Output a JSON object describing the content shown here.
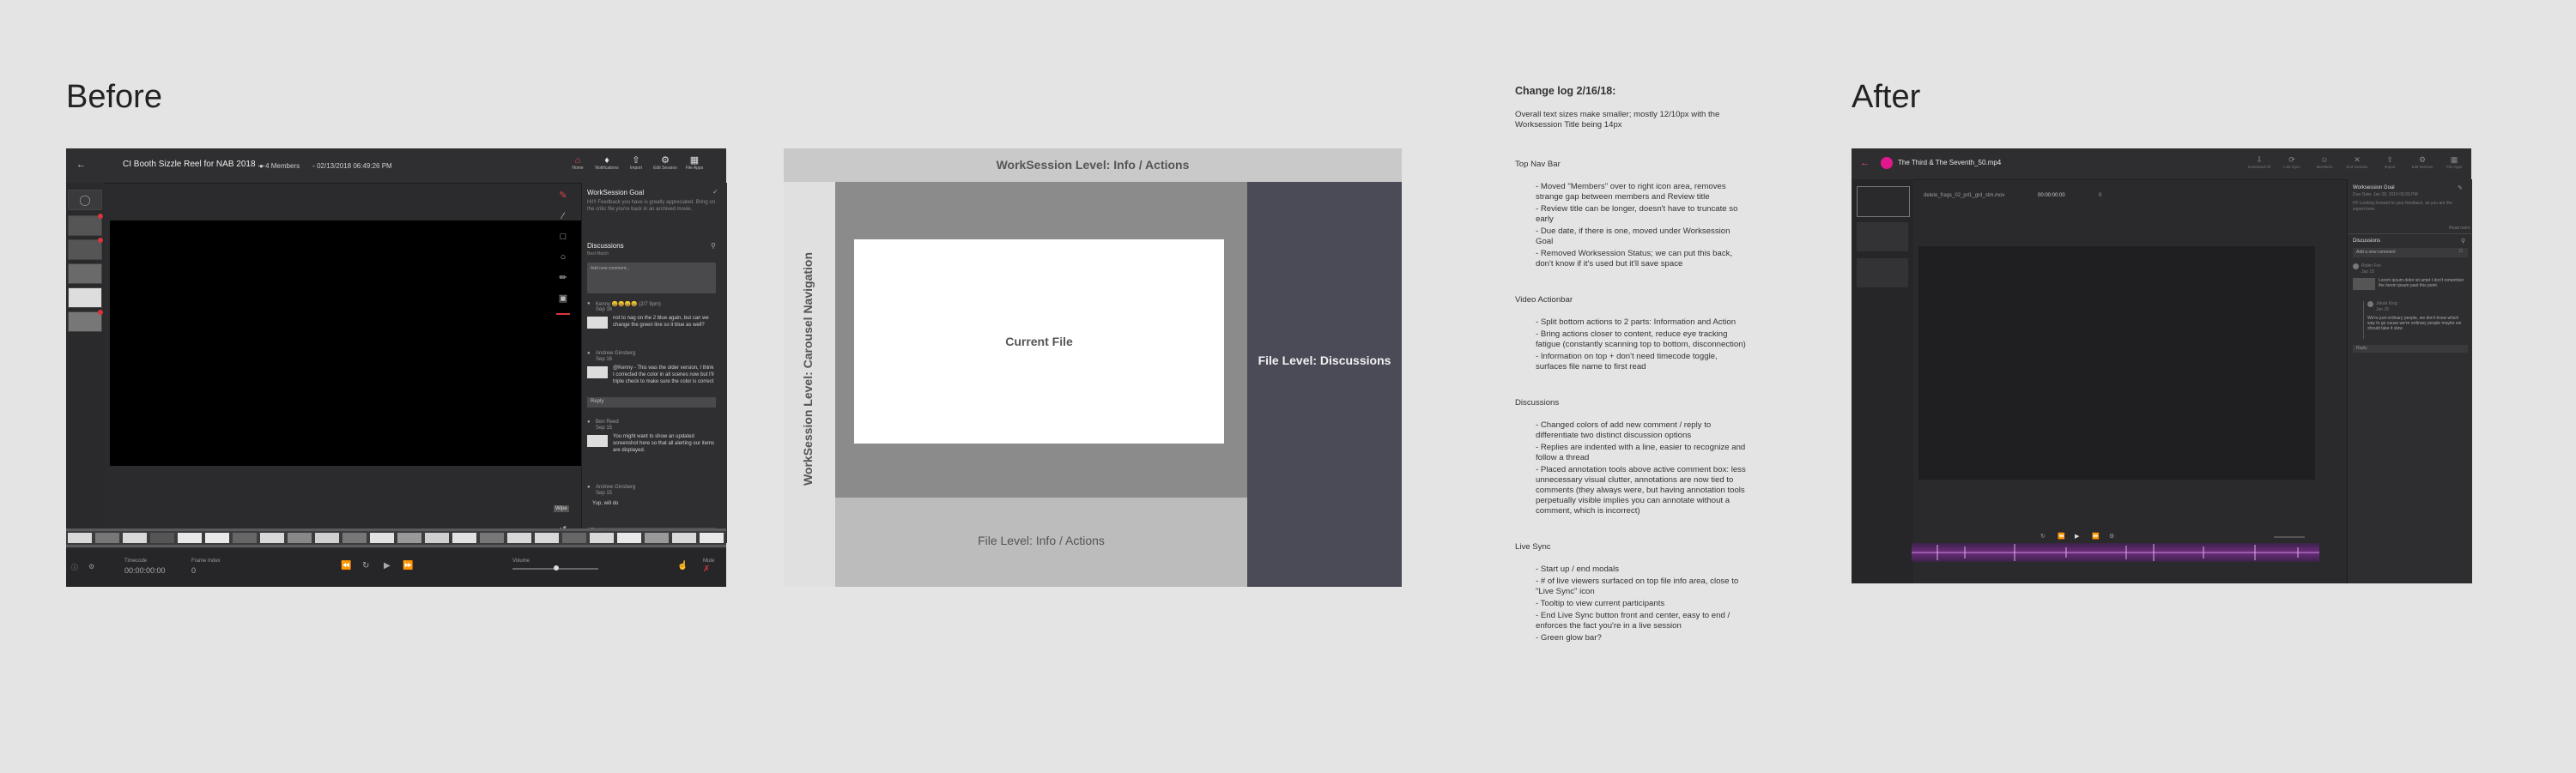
{
  "headings": {
    "before": "Before",
    "after": "After"
  },
  "before_ui": {
    "title": "CI Booth Sizzle Reel for NAB 2018 ...",
    "members": "4 Members",
    "date": "02/13/2018 06:49:26 PM",
    "nav": [
      {
        "icon": "home-icon",
        "label": "Home"
      },
      {
        "icon": "bell-icon",
        "label": "Notifications"
      },
      {
        "icon": "upload-icon",
        "label": "Import"
      },
      {
        "icon": "gear-icon",
        "label": "Edit Session"
      },
      {
        "icon": "grid-icon",
        "label": "File Apps"
      }
    ],
    "goal_title": "WorkSession Goal",
    "goal_text": "Hi!!! Feedback you have is greatly appreciated. Bring on the critic file you're back in an archived movie.",
    "discussions_title": "Discussions",
    "discussions_sub": "Best Match",
    "comment_placeholder": "Add new comment...",
    "comments": [
      {
        "author": "Kenny 😀😀😀😀 (2/7 9pm)",
        "time": "Sep 16",
        "text": "not to nag on the 2 blue again, but can we change the green line so it blue as well?"
      },
      {
        "author": "Andrew Ginsberg",
        "time": "Sep 16",
        "text": "@Kenny - This was the older version, I think I corrected the color in all scenes now but I'll triple check to make sure the color is correct"
      },
      {
        "author": "Ben Reed",
        "time": "Sep 15",
        "text": "You might want to show an updated screenshot here so that all alerting our items are displayed."
      },
      {
        "author": "Andrew Ginsberg",
        "time": "Sep 15",
        "text": "Yup, will do"
      }
    ],
    "reply_label": "Reply",
    "timecode_label": "Timecode",
    "timecode": "00:00:00:00",
    "frame_label": "Frame Index",
    "frame": "0",
    "volume_label": "Volume",
    "mute_label": "Mute"
  },
  "wireframe": {
    "top": "WorkSession Level: Info / Actions",
    "left": "WorkSession Level: Carousel Navigation",
    "center": "Current File",
    "bottom": "File Level: Info / Actions",
    "right": "File Level: Discussions"
  },
  "changelog": {
    "title": "Change log 2/16/18:",
    "intro": "Overall text sizes make smaller; mostly 12/10px with the Worksession Title being 14px",
    "sections": [
      {
        "title": "Top Nav Bar",
        "items": [
          "- Moved \"Members\" over to right icon area, removes strange gap between members and Review title",
          "- Review title can be longer, doesn't have to truncate so early",
          "- Due date, if there is one, moved under Worksession Goal",
          "- Removed Worksession Status; we can put this back, don't know if it's used but it'll save space"
        ]
      },
      {
        "title": "Video Actionbar",
        "items": [
          "- Split bottom actions to 2 parts: Information and Action",
          "- Bring actions closer to content, reduce eye tracking fatigue (constantly scanning top to bottom, disconnection)",
          "- Information on top + don't need timecode toggle, surfaces file name to first read"
        ]
      },
      {
        "title": "Discussions",
        "items": [
          "- Changed colors of add new comment / reply to differentiate two distinct discussion options",
          "- Replies are indented with a line, easier to recognize and follow a thread",
          "- Placed annotation tools above active comment box: less unnecessary visual clutter, annotations are now tied to comments (they always were, but having annotation tools perpetually visible implies you can annotate without a comment, which is incorrect)"
        ]
      },
      {
        "title": "Live Sync",
        "items": [
          "- Start up / end modals",
          "- # of live viewers surfaced on top file info area, close to \"Live Sync\" icon",
          "- Tooltip to view current participants",
          "- End Live Sync button front and center, easy to end / enforces the fact you're in a live session",
          "- Green glow bar?"
        ]
      }
    ]
  },
  "after_ui": {
    "title": "The Third & The Seventh_50.mp4",
    "nav": [
      {
        "icon": "download-icon",
        "label": "Download All"
      },
      {
        "icon": "live-sync-icon",
        "label": "Live Sync"
      },
      {
        "icon": "members-icon",
        "label": "Members"
      },
      {
        "icon": "close-icon",
        "label": "End Session"
      },
      {
        "icon": "upload-icon",
        "label": "Import"
      },
      {
        "icon": "gear-icon",
        "label": "Edit Session"
      },
      {
        "icon": "grid-icon",
        "label": "File Apps"
      }
    ],
    "file_name": "delete_frags_02_prl1_grd_stm.mov",
    "timecode": "00:00:00:00",
    "frame": "0",
    "goal_title": "Worksession Goal",
    "goal_date": "Due Date: Jan 28, 2019 06:00 PM",
    "goal_text": "Hi! Looking forward to your feedback, as you are the expert here.",
    "read_more": "Read more",
    "discussions_title": "Discussions",
    "comment_placeholder": "Add a new comment",
    "comments": [
      {
        "author": "Robin Fox",
        "time": "Jan 15",
        "text": "Lorem ipsum dolor sit amet I don't remember the lorem ipsum past this point."
      },
      {
        "author": "Jakob King",
        "time": "Jan 15",
        "text": "We're just ordinary people, we don't know which way to go cause we're ordinary people maybe we should take it slow"
      }
    ],
    "reply_label": "Reply"
  }
}
